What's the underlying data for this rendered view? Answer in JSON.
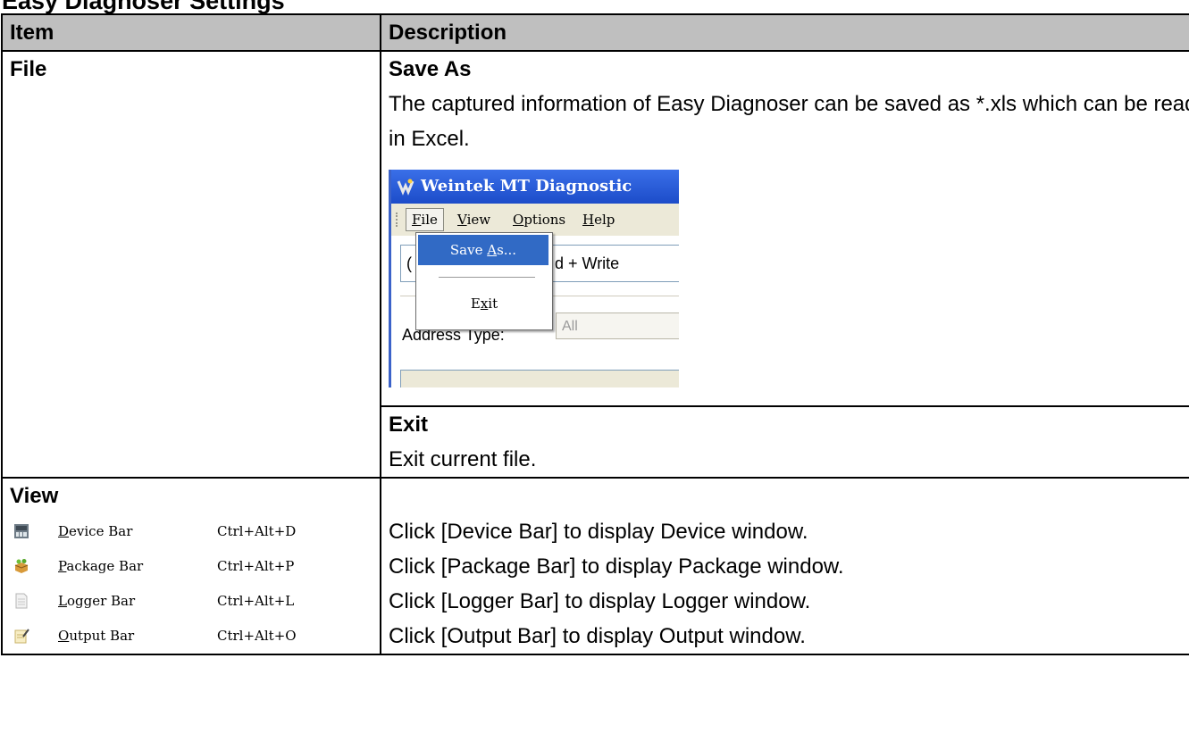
{
  "page_heading": "Easy Diagnoser Settings",
  "table": {
    "header": {
      "item": "Item",
      "description": "Description"
    },
    "file_row": {
      "item": "File",
      "save_as": {
        "title": "Save As",
        "text": "The captured information of Easy Diagnoser can be saved as *.xls which can be read in Excel."
      },
      "exit": {
        "title": "Exit",
        "text": "Exit current file."
      }
    },
    "view_row": {
      "item": "View",
      "menu_items": [
        {
          "icon": "device-bar-icon",
          "label": "Device Bar",
          "accel": "D",
          "rest": "evice Bar",
          "shortcut": "Ctrl+Alt+D",
          "description": "Click [Device Bar] to display Device window."
        },
        {
          "icon": "package-bar-icon",
          "label": "Package Bar",
          "accel": "P",
          "rest": "ackage Bar",
          "shortcut": "Ctrl+Alt+P",
          "description": "Click [Package Bar] to display Package window."
        },
        {
          "icon": "logger-bar-icon",
          "label": "Logger Bar",
          "accel": "L",
          "rest": "ogger Bar",
          "shortcut": "Ctrl+Alt+L",
          "description": "Click [Logger Bar] to display Logger window."
        },
        {
          "icon": "output-bar-icon",
          "label": "Output Bar",
          "accel": "O",
          "rest": "utput Bar",
          "shortcut": "Ctrl+Alt+O",
          "description": "Click [Output Bar] to display Output window."
        }
      ]
    }
  },
  "screenshot": {
    "window_title": "Weintek MT Diagnostic",
    "menu": {
      "file": "File",
      "view": "View",
      "options": "Options",
      "help": "Help"
    },
    "dropdown": {
      "save_as": "Save As...",
      "exit": "Exit"
    },
    "combo_left": "(",
    "combo_text": "d + Write",
    "address_label": "Address Type:",
    "address_value": "All"
  }
}
